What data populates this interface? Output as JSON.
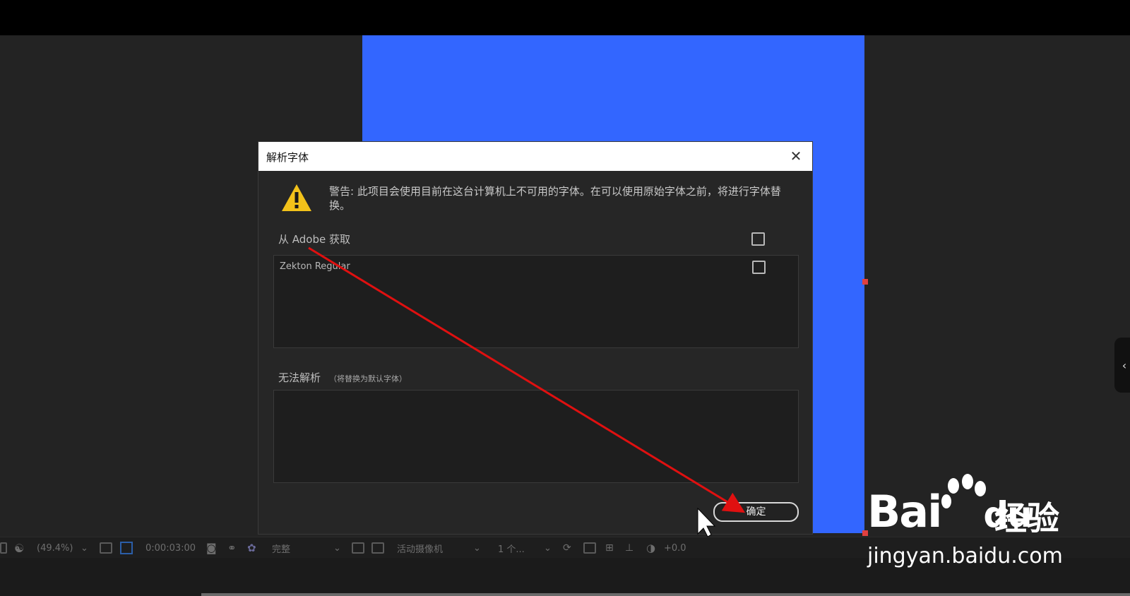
{
  "dialog": {
    "title": "解析字体",
    "close_glyph": "✕",
    "warning_text": "警告: 此项目会使用目前在这台计算机上不可用的字体。在可以使用原始字体之前，将进行字体替换。",
    "adobe_section_label": "从 Adobe 获取",
    "adobe_fonts": [
      "Zekton Regular"
    ],
    "unresolved_label": "无法解析",
    "unresolved_hint": "（将替换为默认字体）",
    "ok_label": "确定"
  },
  "toolbar": {
    "zoom": "(49.4%)",
    "timecode": "0:00:03:00",
    "resolution": "完整",
    "camera": "活动摄像机",
    "views": "1 个...",
    "exposure": "+0.0"
  },
  "right_tab": {
    "glyph": "‹"
  },
  "watermark": {
    "brand": "Bai",
    "paw": "du",
    "cn": "经验",
    "url": "jingyan.baidu.com"
  },
  "colors": {
    "composition": "#3366ff",
    "arrow": "#e01010",
    "dialog_bg": "#262626"
  }
}
